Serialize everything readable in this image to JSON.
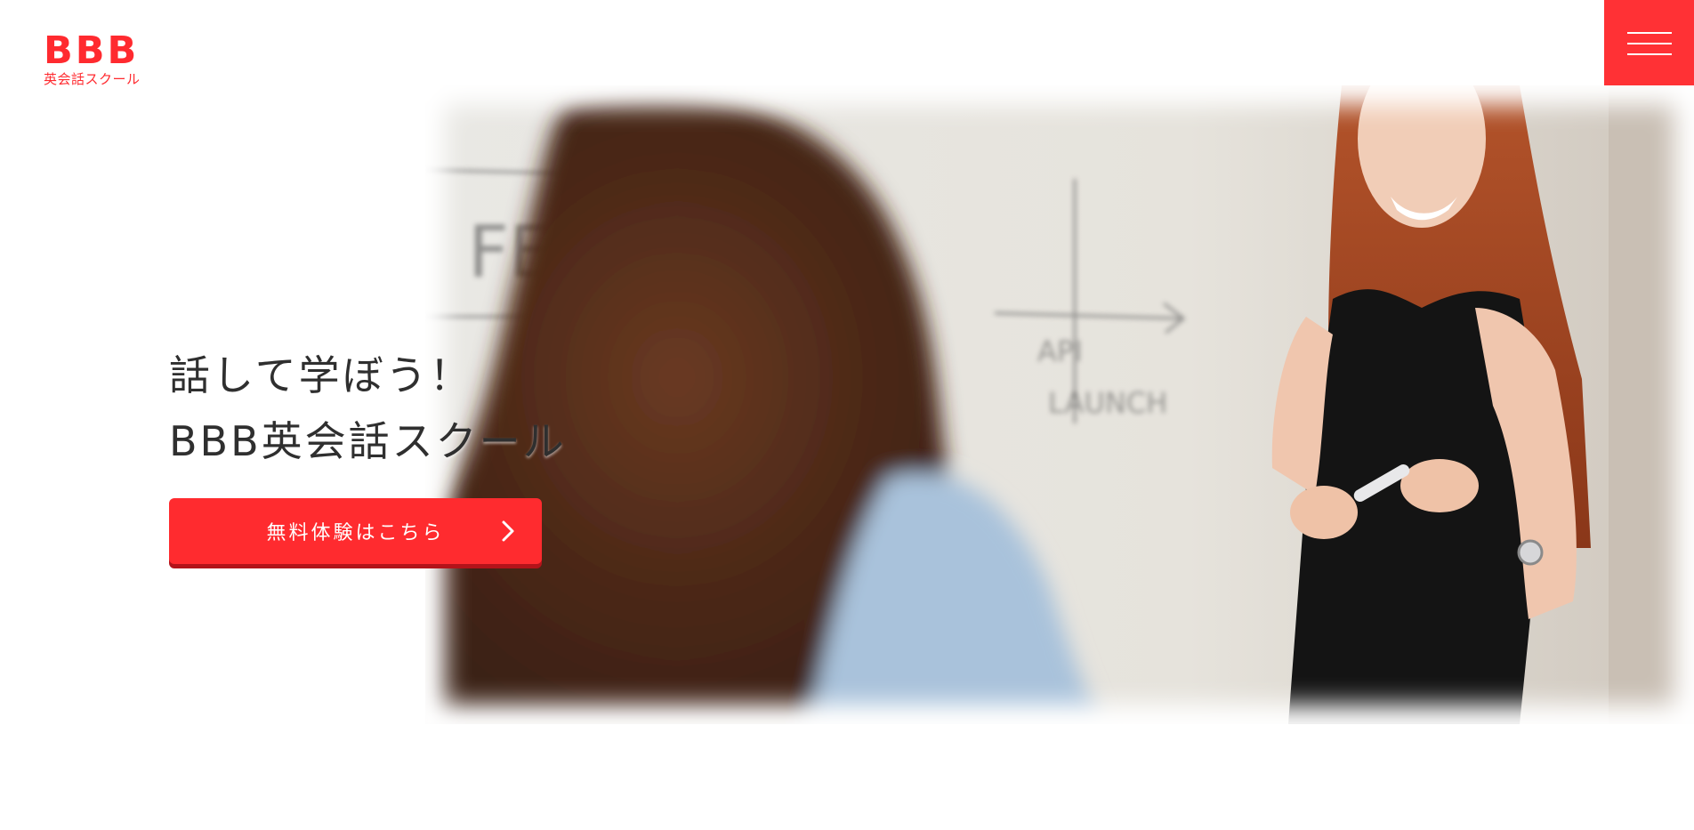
{
  "brand": {
    "logo_mark": "BBB",
    "logo_sub": "英会話スクール",
    "accent_color": "#ff2b2f"
  },
  "header": {
    "menu_icon": "hamburger-menu-icon"
  },
  "hero": {
    "headline_line1": "話して学ぼう！",
    "headline_line2": "BBB英会話スクール",
    "cta_label": "無料体験はこちら",
    "cta_icon": "chevron-right-icon",
    "image_alt": "Teacher smiling at a student in front of a whiteboard",
    "whiteboard_text": [
      "FEE",
      "API",
      "LAUNCH"
    ]
  }
}
